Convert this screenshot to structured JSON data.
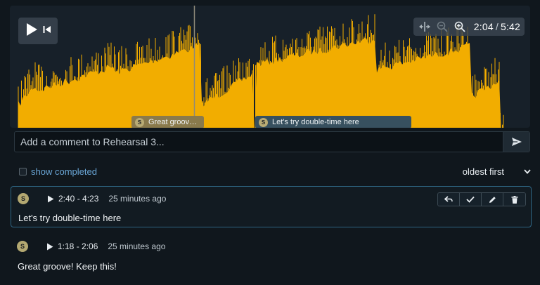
{
  "player": {
    "current_time": "2:04",
    "duration": "5:42",
    "playhead_fraction": 0.3625,
    "waveform_color": "#f2ad00",
    "icons": [
      "play-icon",
      "skip-back-icon",
      "fit-width-icon",
      "zoom-out-icon",
      "zoom-in-icon"
    ]
  },
  "markers": [
    {
      "avatar": "S",
      "text": "Great groove!..."
    },
    {
      "avatar": "S",
      "text": "Let's try double-time here"
    }
  ],
  "comment_input": {
    "placeholder": "Add a comment to Rehearsal 3..."
  },
  "filters": {
    "show_completed_label": "show completed",
    "show_completed_checked": false,
    "sort_label": "oldest first"
  },
  "comments": [
    {
      "avatar": "S",
      "range": "2:40 - 4:23",
      "ago": "25 minutes ago",
      "text": "Let's try double-time here",
      "selected": true
    },
    {
      "avatar": "S",
      "range": "1:18 - 2:06",
      "ago": "25 minutes ago",
      "text": "Great groove! Keep this!",
      "selected": false
    }
  ],
  "colors": {
    "accent_link": "#6aa6d6",
    "selected_border": "#2e6583",
    "background": "#10171d"
  }
}
